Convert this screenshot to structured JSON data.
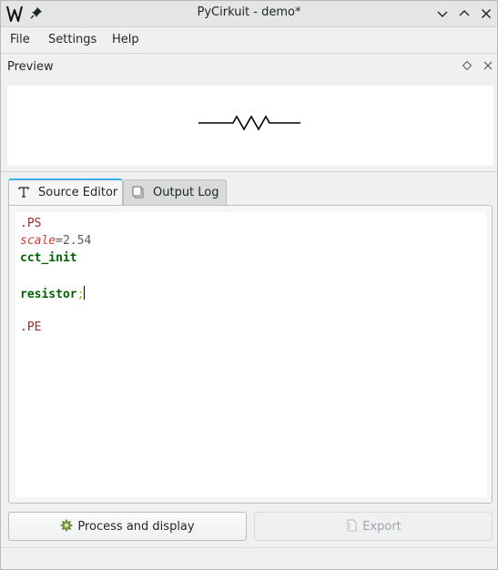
{
  "window": {
    "title": "PyCirkuit - demo*",
    "icons": [
      "app-logo-icon",
      "pin-icon",
      "chevron-down-icon",
      "chevron-up-icon",
      "close-icon"
    ]
  },
  "menubar": {
    "items": [
      {
        "label": "File"
      },
      {
        "label": "Settings"
      },
      {
        "label": "Help"
      }
    ]
  },
  "preview": {
    "title": "Preview",
    "icons": [
      "float-icon",
      "close-icon"
    ]
  },
  "tabs": [
    {
      "label": "Source Editor",
      "icon": "text-icon",
      "active": true
    },
    {
      "label": "Output Log",
      "icon": "log-icon",
      "active": false
    }
  ],
  "editor": {
    "lines": [
      [
        {
          "text": ".PS",
          "style": "ps"
        }
      ],
      [
        {
          "text": "scale",
          "style": "kw-italic"
        },
        {
          "text": "=2.54",
          "style": "num"
        }
      ],
      [
        {
          "text": "cct_init",
          "style": "macro"
        }
      ],
      [
        {
          "text": "",
          "style": "plain"
        }
      ],
      [
        {
          "text": "resistor",
          "style": "macro"
        },
        {
          "text": ";",
          "style": "semicolon"
        }
      ],
      [
        {
          "text": "",
          "style": "plain"
        }
      ],
      [
        {
          "text": ".PE",
          "style": "ps"
        }
      ]
    ]
  },
  "buttons": {
    "process_label": "Process and display",
    "export_label": "Export",
    "export_enabled": false
  },
  "colors": {
    "accent": "#3daee9",
    "ps_directive": "#a12b2b",
    "keyword": "#d03b3b",
    "macro": "#006400"
  }
}
